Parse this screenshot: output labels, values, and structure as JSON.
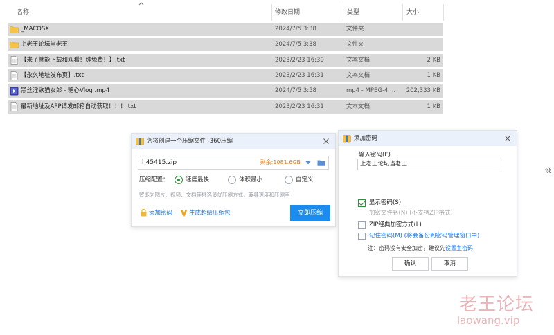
{
  "file_list": {
    "columns": {
      "name": "名称",
      "date": "修改日期",
      "type": "类型",
      "size": "大小"
    },
    "rows": [
      {
        "icon": "folder-icon",
        "name": "_MACOSX",
        "date": "2024/7/5 3:38",
        "type": "文件夹",
        "size": ""
      },
      {
        "icon": "folder-icon",
        "name": "上老王论坛当老王",
        "date": "2024/7/5 3:38",
        "type": "文件夹",
        "size": ""
      },
      {
        "icon": "text-file-icon",
        "name": "【来了就能下载和观看！纯免费！】.txt",
        "date": "2023/2/23 16:30",
        "type": "文本文档",
        "size": "2 KB"
      },
      {
        "icon": "text-file-icon",
        "name": "【永久地址发布页】.txt",
        "date": "2023/2/23 16:31",
        "type": "文本文档",
        "size": "1 KB"
      },
      {
        "icon": "video-file-icon",
        "name": "黑丝淫欲猫女郎 - 糖心Vlog .mp4",
        "date": "2024/7/5 3:58",
        "type": "mp4 - MPEG-4 ...",
        "size": "202,333 KB"
      },
      {
        "icon": "text-file-icon",
        "name": "最新地址及APP请发邮箱自动获取！！！.txt",
        "date": "2023/2/23 16:31",
        "type": "文本文档",
        "size": "1 KB"
      }
    ]
  },
  "compress_dialog": {
    "title": "您将创建一个压缩文件 -360压缩",
    "filename": "h45415.zip",
    "remaining": "剩余:1081.6GB",
    "config_label": "压缩配置：",
    "options": [
      "速度最快",
      "体积最小",
      "自定义"
    ],
    "selected_option": "速度最快",
    "hint": "智能为图片、视频、文档等挑选最优压缩方式，兼具速度和压缩率",
    "add_password": "添加密码",
    "super_package": "生成超级压缩包",
    "compress_button": "立即压缩"
  },
  "password_dialog": {
    "title": "添加密码",
    "input_label": "输入密码(E)",
    "password_value": "上老王论坛当老王",
    "show_password": "显示密码(S)",
    "encrypt_filename": "加密文件名(N) (不支持ZIP格式)",
    "zip_classic": "ZIP经典加密方式(L)",
    "remember_password": "记住密码(M) (将会备份到密码管理窗口中)",
    "note_prefix": "注：密码没有安全加密，建议先",
    "note_link": "设置主密码",
    "ok_button": "确认",
    "cancel_button": "取消"
  },
  "edge_text": "设",
  "watermark": {
    "cn": "老王论坛",
    "en": "laowang.vip"
  },
  "colors": {
    "accent": "#1a8cf0",
    "selection": "#d9d9d9",
    "dialog_title": "#eaf1fa",
    "check_green": "#2f8f3a",
    "watermark": "#e9b5b8"
  }
}
